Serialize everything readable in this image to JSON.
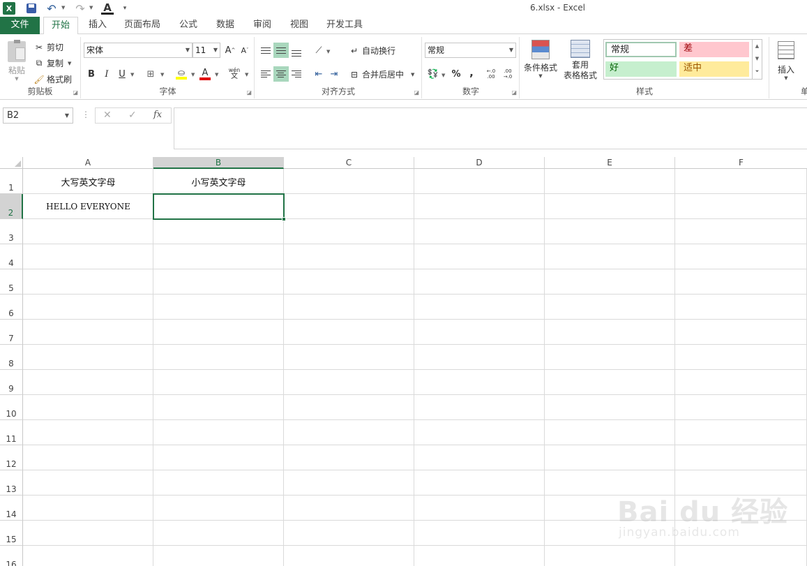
{
  "title_bar": {
    "window_title": "6.xlsx - Excel",
    "app_logo": "X",
    "icons": [
      "excel-logo-icon",
      "save-icon",
      "undo-icon",
      "redo-icon",
      "font-color-icon",
      "customize-qat-icon"
    ]
  },
  "tabs": [
    {
      "label": "文件",
      "kind": "file"
    },
    {
      "label": "开始",
      "kind": "active"
    },
    {
      "label": "插入"
    },
    {
      "label": "页面布局"
    },
    {
      "label": "公式"
    },
    {
      "label": "数据"
    },
    {
      "label": "审阅"
    },
    {
      "label": "视图"
    },
    {
      "label": "开发工具"
    }
  ],
  "ribbon": {
    "clipboard": {
      "label": "剪贴板",
      "paste": "粘贴",
      "cut": "剪切",
      "copy": "复制",
      "format_painter": "格式刷"
    },
    "font": {
      "label": "字体",
      "font_name": "宋体",
      "font_size": "11",
      "bold": "B",
      "italic": "I",
      "underline": "U",
      "font_color_letter": "A",
      "phonetic_top": "wén",
      "phonetic_bottom": "文",
      "grow": "A",
      "shrink": "A"
    },
    "alignment": {
      "label": "对齐方式",
      "wrap_text": "自动换行",
      "merge_center": "合并后居中"
    },
    "number": {
      "label": "数字",
      "format": "常规",
      "percent": "%",
      "comma": ",",
      "inc_decimal_top": "←.0",
      "inc_decimal_bottom": ".00",
      "dec_decimal_top": ".00",
      "dec_decimal_bottom": "→.0"
    },
    "styles": {
      "label": "样式",
      "conditional_formatting": "条件格式",
      "format_as_table_1": "套用",
      "format_as_table_2": "表格格式",
      "cell_styles": [
        {
          "name": "常规",
          "bg": "#ffffff",
          "fg": "#000000"
        },
        {
          "name": "差",
          "bg": "#ffc7ce",
          "fg": "#9c0006"
        },
        {
          "name": "好",
          "bg": "#c6efce",
          "fg": "#006100"
        },
        {
          "name": "适中",
          "bg": "#ffeb9c",
          "fg": "#9c5700"
        }
      ]
    },
    "cells": {
      "insert": "插入",
      "truncated_next": "单"
    }
  },
  "formula_bar": {
    "name_box": "B2",
    "cancel": "✕",
    "enter": "✓",
    "fx": "fx",
    "content": ""
  },
  "sheet": {
    "columns": [
      "A",
      "B",
      "C",
      "D",
      "E",
      "F"
    ],
    "selected_column": "B",
    "rows": [
      "1",
      "2",
      "3",
      "4",
      "5",
      "6",
      "7",
      "8",
      "9",
      "10",
      "11",
      "12",
      "13",
      "14",
      "15",
      "16"
    ],
    "selected_row": "2",
    "cells": {
      "A1": "大写英文字母",
      "B1": "小写英文字母",
      "A2": "HELLO EVERYONE",
      "B2": ""
    },
    "active_cell": "B2",
    "accent": "#217346"
  },
  "watermark": {
    "text": "Bai du 经验",
    "url": "jingyan.baidu.com"
  }
}
